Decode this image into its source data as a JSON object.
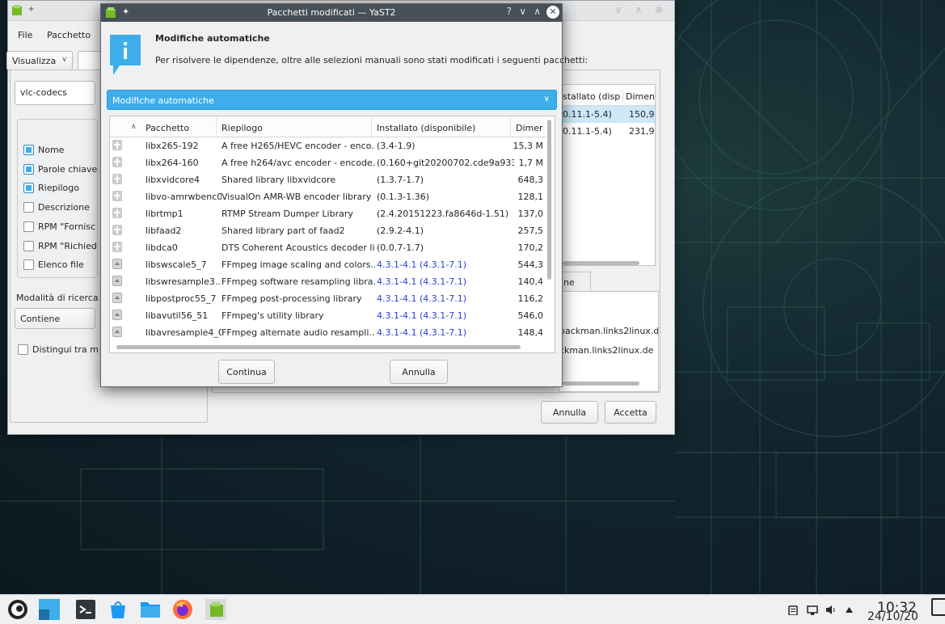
{
  "background_window": {
    "menu": [
      "File",
      "Pacchetto"
    ],
    "view_combo": "Visualizza",
    "search_value": "vlc-codecs",
    "search_in": [
      {
        "label": "Nome",
        "checked": true
      },
      {
        "label": "Parole chiave",
        "checked": true
      },
      {
        "label": "Riepilogo",
        "checked": true
      },
      {
        "label": "Descrizione",
        "checked": false
      },
      {
        "label": "RPM \"Fornisc",
        "checked": false
      },
      {
        "label": "RPM \"Richied",
        "checked": false
      },
      {
        "label": "Elenco file",
        "checked": false
      }
    ],
    "search_mode_label": "Modalità di ricerca",
    "search_mode_value": "Contiene",
    "case_sensitive_label": "Distingui tra m",
    "package_table": {
      "headers": [
        "stallato (disp",
        "Dimensi"
      ],
      "rows": [
        {
          "installed": "0.11.1-5.4)",
          "size": "150,9 l"
        },
        {
          "installed": "0.11.1-5.4)",
          "size": "231,9 l"
        }
      ]
    },
    "tab_label": "ne",
    "info_lines": [
      "packman.links2linux.d",
      "ckman.links2linux.de"
    ],
    "cancel_label": "Annulla",
    "accept_label": "Accetta"
  },
  "dialog": {
    "title": "Pacchetti modificati — YaST2",
    "title_controls": [
      "?",
      "∨",
      "∧"
    ],
    "heading": "Modifiche automatiche",
    "message": "Per risolvere le dipendenze, oltre alle selezioni manuali sono stati modificati i seguenti pacchetti:",
    "filter_combo": "Modifiche automatiche",
    "table": {
      "headers": [
        "Pacchetto",
        "Riepilogo",
        "Installato (disponibile)",
        "Dimer"
      ],
      "rows": [
        {
          "status": "install",
          "name": "libx265-192",
          "summary": "A free H265/HEVC encoder - enco...",
          "installed": "(3.4-1.9)",
          "size": "15,3 M"
        },
        {
          "status": "install",
          "name": "libx264-160",
          "summary": "A free h264/avc encoder - encode...",
          "installed": "(0.160+git20200702.cde9a933-...",
          "size": "1,7 M"
        },
        {
          "status": "install",
          "name": "libxvidcore4",
          "summary": "Shared library libxvidcore",
          "installed": "(1.3.7-1.7)",
          "size": "648,3"
        },
        {
          "status": "install",
          "name": "libvo-amrwbenc0",
          "summary": "VisualOn AMR-WB encoder library",
          "installed": "(0.1.3-1.36)",
          "size": "128,1"
        },
        {
          "status": "install",
          "name": "librtmp1",
          "summary": "RTMP Stream Dumper Library",
          "installed": "(2.4.20151223.fa8646d-1.51)",
          "size": "137,0"
        },
        {
          "status": "install",
          "name": "libfaad2",
          "summary": "Shared library part of faad2",
          "installed": "(2.9.2-4.1)",
          "size": "257,5"
        },
        {
          "status": "install",
          "name": "libdca0",
          "summary": "DTS Coherent Acoustics decoder li...",
          "installed": "(0.0.7-1.7)",
          "size": "170,2"
        },
        {
          "status": "update",
          "name": "libswscale5_7",
          "summary": "FFmpeg image scaling and colors...",
          "installed": "4.3.1-4.1 (4.3.1-7.1)",
          "size": "544,3"
        },
        {
          "status": "update",
          "name": "libswresample3...",
          "summary": "FFmpeg software resampling libra...",
          "installed": "4.3.1-4.1 (4.3.1-7.1)",
          "size": "140,4"
        },
        {
          "status": "update",
          "name": "libpostproc55_7",
          "summary": "FFmpeg post-processing library",
          "installed": "4.3.1-4.1 (4.3.1-7.1)",
          "size": "116,2"
        },
        {
          "status": "update",
          "name": "libavutil56_51",
          "summary": "FFmpeg's utility library",
          "installed": "4.3.1-4.1 (4.3.1-7.1)",
          "size": "546,0"
        },
        {
          "status": "update",
          "name": "libavresample4_0",
          "summary": "FFmpeg alternate audio resampli...",
          "installed": "4.3.1-4.1 (4.3.1-7.1)",
          "size": "148,4"
        }
      ]
    },
    "continue_label": "Continua",
    "cancel_label": "Annulla"
  },
  "taskbar": {
    "apps": [
      "application-launcher-icon",
      "desktop-pager-icon",
      "konsole-icon",
      "discover-icon",
      "dolphin-icon",
      "firefox-icon",
      "yast-icon"
    ],
    "clock_time": "10:32",
    "clock_date": "24/10/20"
  },
  "colors": {
    "accent": "#3daee9",
    "titlebar_active": "#475057",
    "link_blue": "#2a3fd8"
  }
}
